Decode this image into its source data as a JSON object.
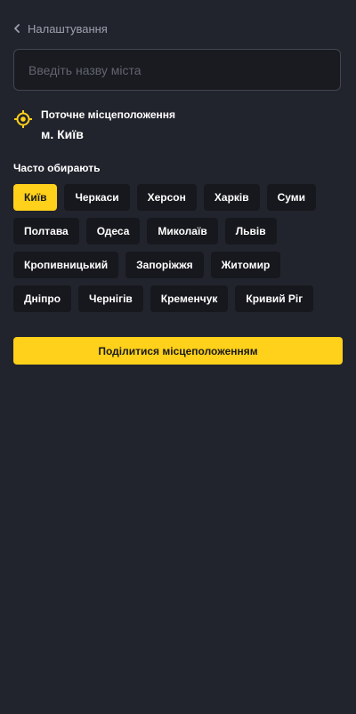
{
  "header": {
    "back_label": "Налаштування"
  },
  "search": {
    "placeholder": "Введіть назву міста",
    "value": ""
  },
  "current_location": {
    "label": "Поточне місцеположення",
    "city": "м. Київ",
    "icon": "location-target-icon"
  },
  "popular": {
    "title": "Часто обирають",
    "selected": "Київ",
    "rows": [
      [
        "Київ",
        "Черкаси",
        "Херсон",
        "Харків",
        "Суми"
      ],
      [
        "Полтава",
        "Одеса",
        "Миколаїв",
        "Львів"
      ],
      [
        "Кропивницький",
        "Запоріжжя",
        "Житомир"
      ],
      [
        "Дніпро",
        "Чернігів",
        "Кременчук",
        "Кривий Ріг"
      ]
    ]
  },
  "share_button_label": "Поділитися місцеположенням",
  "colors": {
    "background": "#22242d",
    "accent": "#ffd11a",
    "chip_background": "#17181d"
  }
}
